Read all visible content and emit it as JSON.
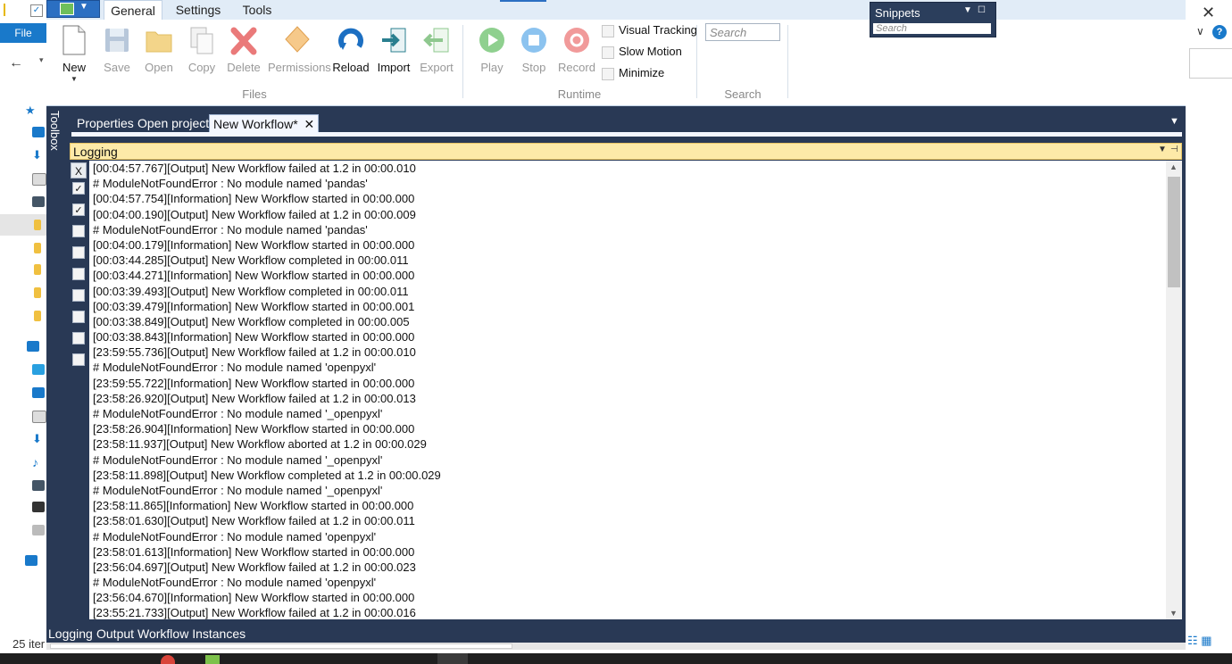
{
  "background_window": {
    "file_label": "File",
    "status_text": "25 iter"
  },
  "app": {
    "ribbon_tabs": [
      "General",
      "Settings",
      "Tools"
    ],
    "files_group": {
      "label": "Files",
      "buttons": [
        "New",
        "Save",
        "Open",
        "Copy",
        "Delete",
        "Permissions",
        "Reload",
        "Import",
        "Export"
      ]
    },
    "runtime_group": {
      "label": "Runtime",
      "buttons": [
        "Play",
        "Stop",
        "Record"
      ],
      "options": [
        "Visual Tracking",
        "Slow Motion",
        "Minimize"
      ]
    },
    "search_group": {
      "label": "Search",
      "placeholder": "Search"
    },
    "snippets": {
      "title": "Snippets",
      "placeholder": "Search"
    },
    "toolbox_label": "Toolbox",
    "doc_tabs": [
      "Properties",
      "Open project",
      "New Workflow*"
    ],
    "logging": {
      "title": "Logging",
      "clear_button": "X",
      "side_checked": [
        true,
        true,
        false,
        false,
        false,
        false,
        false,
        false,
        false
      ],
      "lines": [
        "[00:04:57.767][Output] New Workflow failed at 1.2 in 00:00.010",
        "# ModuleNotFoundError : No module named 'pandas'",
        "[00:04:57.754][Information] New Workflow started in 00:00.000",
        "[00:04:00.190][Output] New Workflow failed at 1.2 in 00:00.009",
        "# ModuleNotFoundError : No module named 'pandas'",
        "[00:04:00.179][Information] New Workflow started in 00:00.000",
        "[00:03:44.285][Output] New Workflow completed in 00:00.011",
        "[00:03:44.271][Information] New Workflow started in 00:00.000",
        "[00:03:39.493][Output] New Workflow completed in 00:00.011",
        "[00:03:39.479][Information] New Workflow started in 00:00.001",
        "[00:03:38.849][Output] New Workflow completed in 00:00.005",
        "[00:03:38.843][Information] New Workflow started in 00:00.000",
        "[23:59:55.736][Output] New Workflow failed at 1.2 in 00:00.010",
        "# ModuleNotFoundError : No module named 'openpyxl'",
        "[23:59:55.722][Information] New Workflow started in 00:00.000",
        "[23:58:26.920][Output] New Workflow failed at 1.2 in 00:00.013",
        "# ModuleNotFoundError : No module named '_openpyxl'",
        "[23:58:26.904][Information] New Workflow started in 00:00.000",
        "[23:58:11.937][Output] New Workflow aborted at 1.2 in 00:00.029",
        "# ModuleNotFoundError : No module named '_openpyxl'",
        "[23:58:11.898][Output] New Workflow completed at 1.2 in 00:00.029",
        "# ModuleNotFoundError : No module named '_openpyxl'",
        "[23:58:11.865][Information] New Workflow started in 00:00.000",
        "[23:58:01.630][Output] New Workflow failed at 1.2 in 00:00.011",
        "# ModuleNotFoundError : No module named 'openpyxl'",
        "[23:58:01.613][Information] New Workflow started in 00:00.000",
        "[23:56:04.697][Output] New Workflow failed at 1.2 in 00:00.023",
        "# ModuleNotFoundError : No module named 'openpyxl'",
        "[23:56:04.670][Information] New Workflow started in 00:00.000",
        "[23:55:21.733][Output] New Workflow failed at 1.2 in 00:00.016"
      ]
    },
    "bottom_tabs": [
      "Logging",
      "Output",
      "Workflow Instances"
    ]
  },
  "colors": {
    "app_bg": "#293955",
    "log_header": "#fdeaa8",
    "accent": "#2b6fc2"
  }
}
